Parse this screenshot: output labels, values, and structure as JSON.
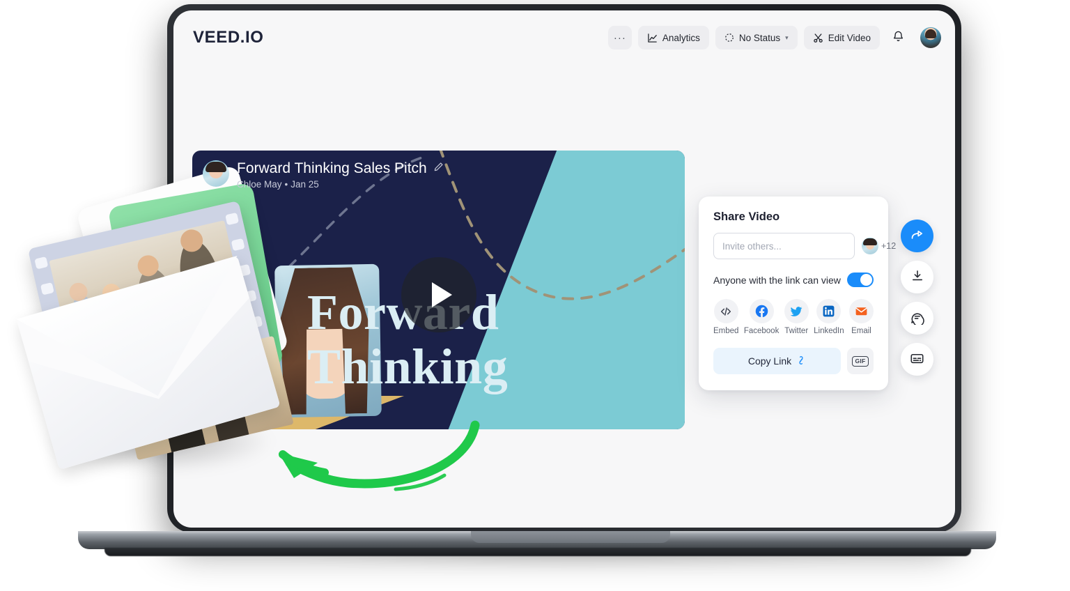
{
  "app": {
    "brand": "VEED.IO",
    "header_buttons": [
      {
        "id": "more",
        "label": "···",
        "icon": "ellipsis-icon"
      },
      {
        "id": "analytics",
        "label": "Analytics",
        "icon": "chart-line-icon"
      },
      {
        "id": "status",
        "label": "No Status",
        "icon": "dashed-circle-icon",
        "caret": "▾"
      },
      {
        "id": "edit-video",
        "label": "Edit Video",
        "icon": "scissors-icon"
      }
    ],
    "bell_icon": "notification-bell-icon",
    "avatar_icon": "user-avatar"
  },
  "video": {
    "title": "Forward Thinking Sales Pitch",
    "edit_icon": "pencil-icon",
    "author": "Chloe May",
    "separator": "•",
    "date": "Jan 25",
    "hero_line1": "Forward",
    "hero_line2": "Thinking",
    "play_icon": "play-icon",
    "colors": {
      "background": "#1b2149",
      "teal_accent": "#7ccbd4",
      "gold_accent": "#dcb869",
      "hero_text": "#dbeef4"
    }
  },
  "share_panel": {
    "title": "Share Video",
    "invite_placeholder": "Invite others...",
    "invite_value": "",
    "invite_more_count": "+12",
    "link_permission_label": "Anyone with the link can view",
    "link_permission_enabled": true,
    "toggle_color": "#1a8cfa",
    "social": [
      {
        "label": "Embed",
        "icon": "code-icon",
        "color": "#3a3f4c"
      },
      {
        "label": "Facebook",
        "icon": "facebook-icon",
        "color": "#1877f2"
      },
      {
        "label": "Twitter",
        "icon": "twitter-icon",
        "color": "#1da1f2"
      },
      {
        "label": "LinkedIn",
        "icon": "linkedin-icon",
        "color": "#0a66c2"
      },
      {
        "label": "Email",
        "icon": "email-icon",
        "color": "#f4621f"
      }
    ],
    "copy_link_label": "Copy Link",
    "copy_link_icon": "chain-link-icon",
    "gif_label": "GIF"
  },
  "action_rail": [
    {
      "id": "share",
      "icon": "share-arrow-icon",
      "active": true
    },
    {
      "id": "download",
      "icon": "download-icon",
      "active": false
    },
    {
      "id": "comment",
      "icon": "comment-icon",
      "active": false
    },
    {
      "id": "subtitles",
      "icon": "subtitles-icon",
      "active": false
    }
  ],
  "decoration": {
    "green_arrow_icon": "curved-arrow-icon",
    "green_arrow_color": "#1fc94a",
    "collage_icon": "film-strip-envelope-illustration"
  }
}
